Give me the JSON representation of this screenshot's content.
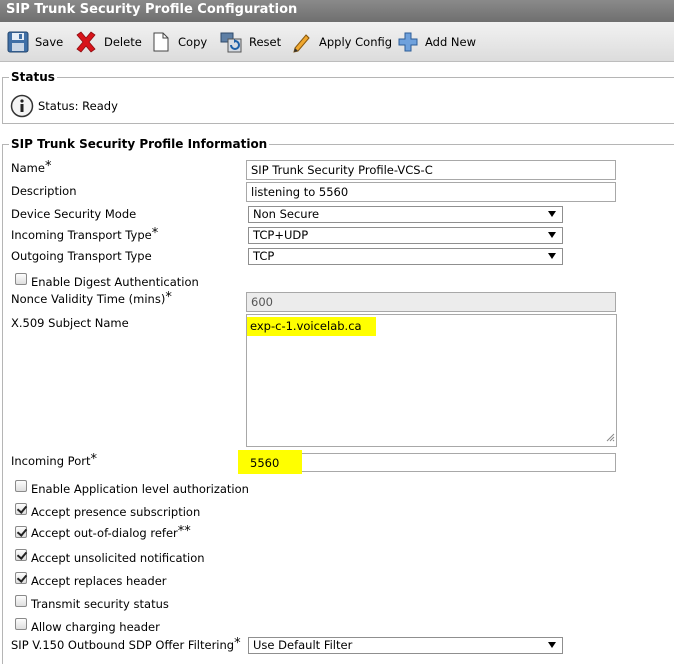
{
  "title": "SIP Trunk Security Profile Configuration",
  "toolbar": {
    "save": "Save",
    "delete": "Delete",
    "copy": "Copy",
    "reset": "Reset",
    "apply_config": "Apply Config",
    "add_new": "Add New"
  },
  "status": {
    "legend": "Status",
    "text": "Status: Ready"
  },
  "info": {
    "legend": "SIP Trunk Security Profile Information",
    "name_label": "Name",
    "name_value": "SIP Trunk Security Profile-VCS-C",
    "description_label": "Description",
    "description_value": "listening to 5560",
    "device_security_mode_label": "Device Security Mode",
    "device_security_mode_value": "Non Secure",
    "incoming_transport_label": "Incoming Transport Type",
    "incoming_transport_value": "TCP+UDP",
    "outgoing_transport_label": "Outgoing Transport Type",
    "outgoing_transport_value": "TCP",
    "enable_digest_label": "Enable Digest Authentication",
    "enable_digest_checked": false,
    "nonce_label": "Nonce Validity Time (mins)",
    "nonce_value": "600",
    "x509_label": "X.509 Subject Name",
    "x509_value": "exp-c-1.voicelab.ca",
    "incoming_port_label": "Incoming Port",
    "incoming_port_value": "5560",
    "required_mark": "*",
    "double_required_mark": "**",
    "checkboxes": [
      {
        "label": "Enable Application level authorization",
        "checked": false
      },
      {
        "label": "Accept presence subscription",
        "checked": true
      },
      {
        "label": "Accept out-of-dialog refer",
        "checked": true
      },
      {
        "label": "Accept unsolicited notification",
        "checked": true
      },
      {
        "label": "Accept replaces header",
        "checked": true
      },
      {
        "label": "Transmit security status",
        "checked": false
      },
      {
        "label": "Allow charging header",
        "checked": false
      }
    ],
    "sip_v150_label": "SIP V.150 Outbound SDP Offer Filtering",
    "sip_v150_value": "Use Default Filter"
  }
}
